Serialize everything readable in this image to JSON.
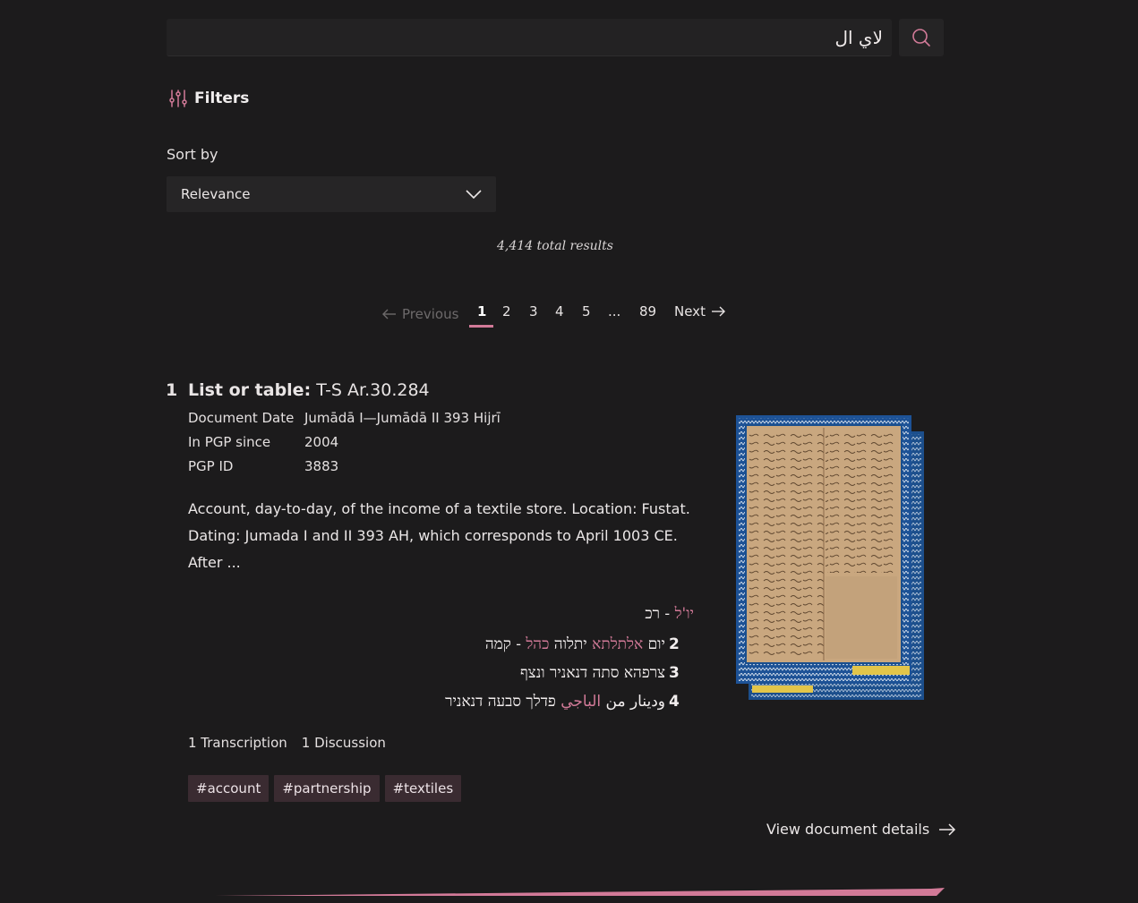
{
  "search": {
    "value": "لاي ال"
  },
  "filters": {
    "label": "Filters"
  },
  "sort": {
    "label": "Sort by",
    "selected": "Relevance"
  },
  "results": {
    "total": "4,414 total results"
  },
  "pagination": {
    "previous": "Previous",
    "pages": [
      "1",
      "2",
      "3",
      "4",
      "5",
      "...",
      "89"
    ],
    "current": "1",
    "next": "Next"
  },
  "result": {
    "index": "1",
    "type": "List or table:",
    "shelfmark": "T-S Ar.30.284",
    "meta": [
      {
        "key": "Document Date",
        "value": "Jumādā I—Jumādā II 393 Hijrī"
      },
      {
        "key": "In PGP since",
        "value": "2004"
      },
      {
        "key": "PGP ID",
        "value": "3883"
      }
    ],
    "description": "Account, day-to-day, of the income of a textile store. Location: Fustat. Dating: Jumada I and II 393 AH, which corresponds to April 1003 CE. After ...",
    "transcription": {
      "line1": {
        "hl": "יו'ל",
        "rest": " - רכ"
      },
      "line2": {
        "num": "2",
        "a": "יום ",
        "hl1": "אלתלתא",
        "b": " יתלוה ",
        "hl2": "כהל",
        "c": " - קמה"
      },
      "line3": {
        "num": "3",
        "text": "צרפהא סתה דנאניר ונצף"
      },
      "line4": {
        "num": "4",
        "a": "ودينار من ",
        "hl": "الباجي",
        "b": " פדלך סבעה דנאניר"
      }
    },
    "counts": {
      "transcriptions": "1 Transcription",
      "discussions": "1 Discussion"
    },
    "tags": [
      "#account",
      "#partnership",
      "#textiles"
    ],
    "details_link": "View document details"
  },
  "colors": {
    "background": "#1c1b1c",
    "accent": "#d27a98",
    "tag_bg": "#3a2b31"
  }
}
